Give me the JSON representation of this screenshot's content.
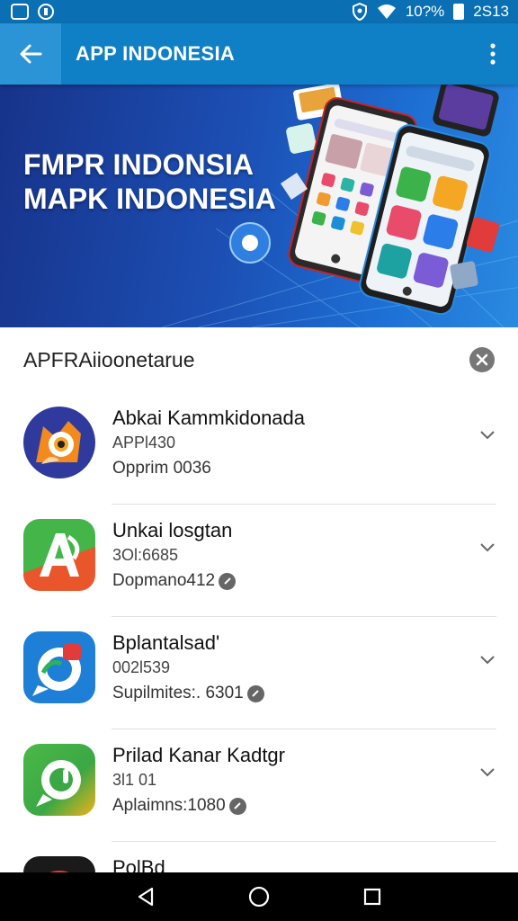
{
  "status_bar": {
    "battery_text": "10?%",
    "time": "2S13",
    "icons": [
      "notification-icon",
      "sync-icon",
      "shield-icon",
      "wifi-icon",
      "battery-icon"
    ]
  },
  "app_bar": {
    "title": "APP INDONESIA",
    "back_icon": "arrow-left-icon",
    "more_icon": "more-vert-icon"
  },
  "banner": {
    "line1": "FMPR INDONSIA",
    "line2": "MAPK INDONESIA"
  },
  "sheet": {
    "title": "APFRAiioonetarue",
    "close_icon": "close-icon",
    "apps": [
      {
        "name": "Abkai Kammkidonada",
        "sub": "APPl430",
        "meta": "Opprim 0036",
        "has_edit": false
      },
      {
        "name": "Unkai losgtan",
        "sub": "3Ol:6685",
        "meta": "Dopmano412",
        "has_edit": true
      },
      {
        "name": "Bplantalsad'",
        "sub": "002l539",
        "meta": "Supilmites:. 6301",
        "has_edit": true
      },
      {
        "name": "Prilad Kanar Kadtgr",
        "sub": "3l1 01",
        "meta": "Aplaimns:1080",
        "has_edit": true
      },
      {
        "name": "PolBd",
        "sub": "",
        "meta": "",
        "has_edit": false
      }
    ]
  },
  "colors": {
    "app_bar": "#0f7fc6",
    "status_bar": "#0a6fb3",
    "banner_dark": "#17338a",
    "nav_bar": "#000000"
  },
  "nav_bar": {
    "icons": [
      "back-triangle-icon",
      "home-circle-icon",
      "recents-square-icon"
    ]
  }
}
